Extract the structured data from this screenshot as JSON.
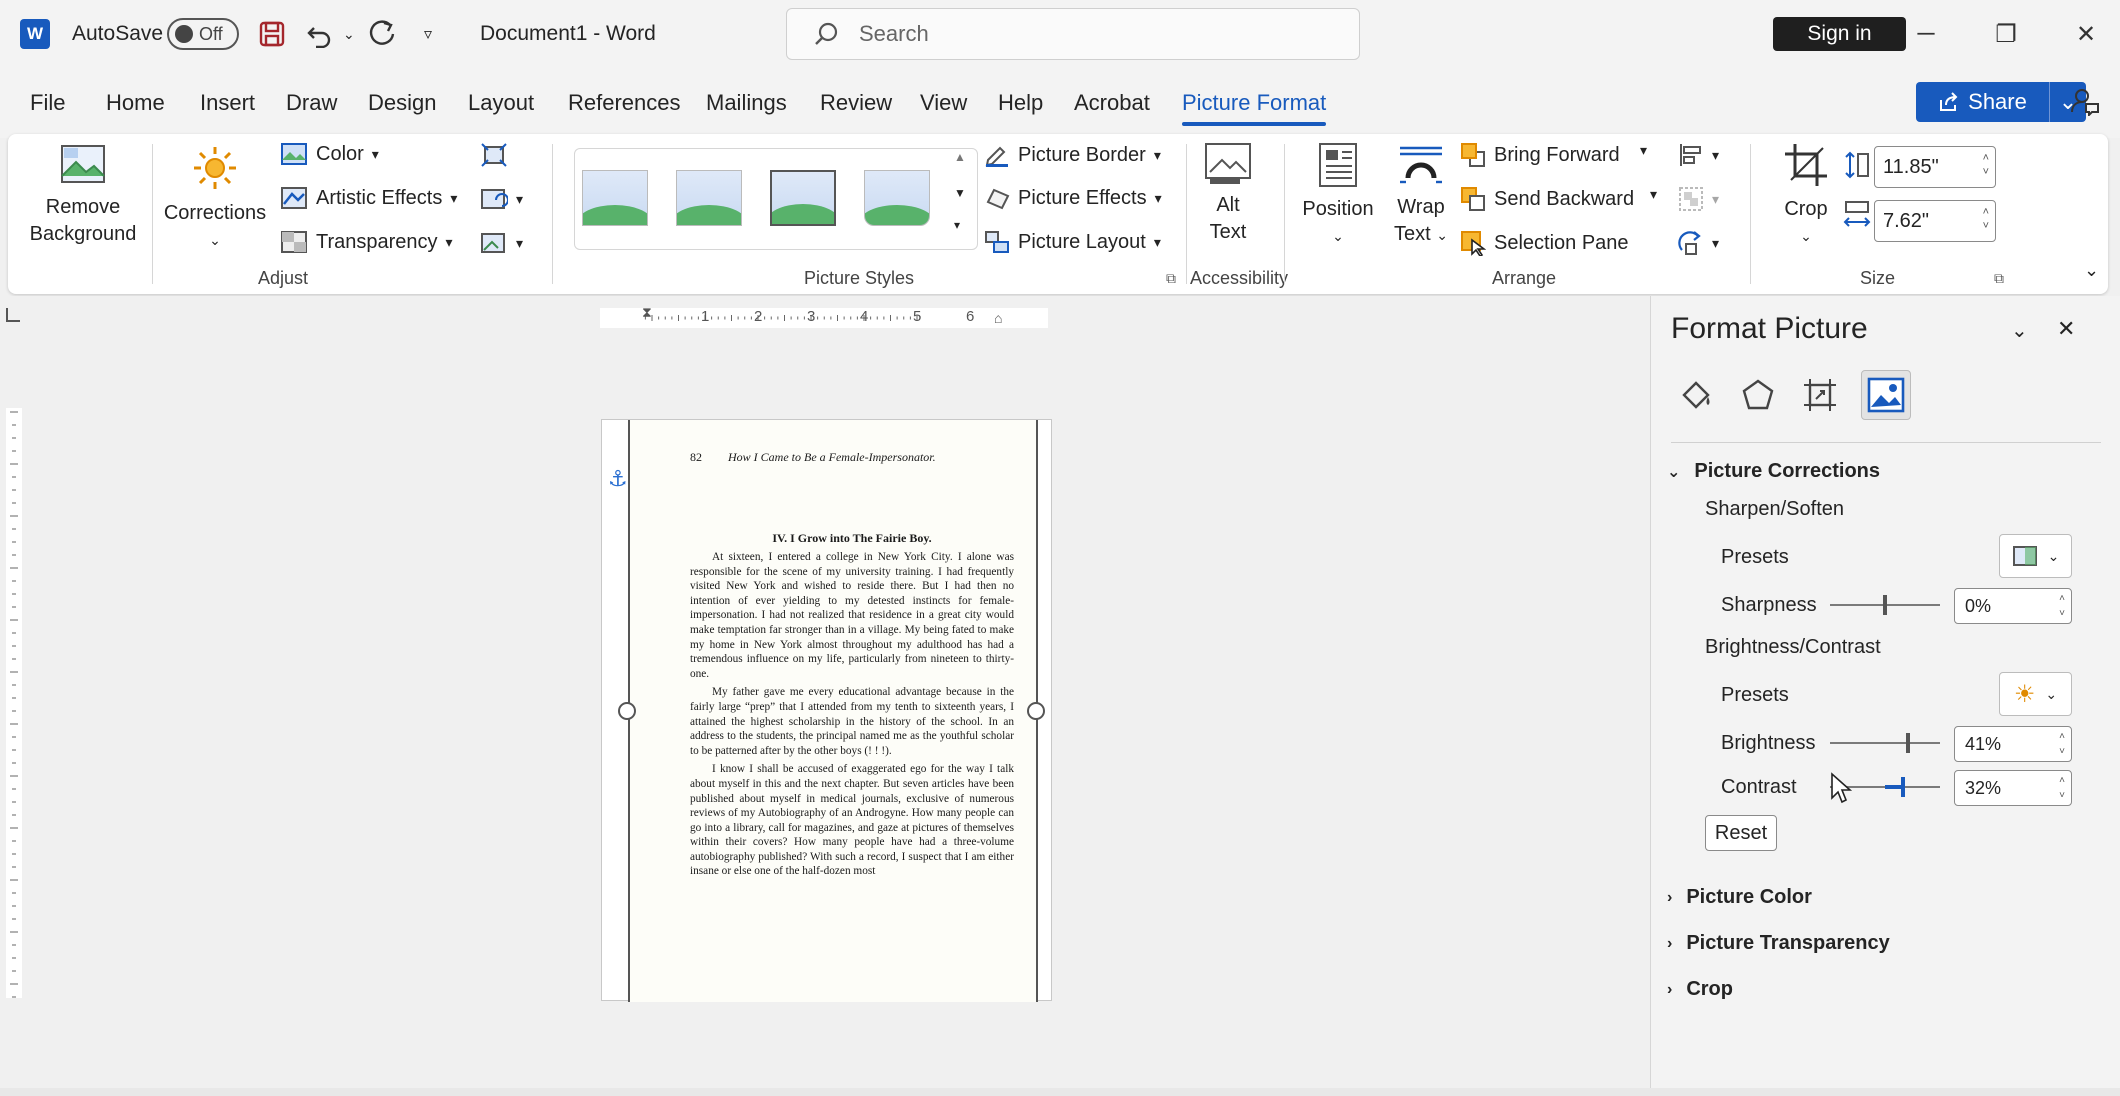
{
  "titlebar": {
    "app_logo": "W",
    "autosave_label": "AutoSave",
    "autosave_state": "Off",
    "doc_title": "Document1  -  Word",
    "search_placeholder": "Search",
    "signin_label": "Sign in",
    "minimize": "─",
    "restore": "❐",
    "close": "✕"
  },
  "tabs": [
    "File",
    "Home",
    "Insert",
    "Draw",
    "Design",
    "Layout",
    "References",
    "Mailings",
    "Review",
    "View",
    "Help",
    "Acrobat",
    "Picture Format"
  ],
  "active_tab": "Picture Format",
  "share_label": "Share",
  "ribbon": {
    "remove_bg": [
      "Remove",
      "Background"
    ],
    "corrections": "Corrections",
    "color": "Color",
    "artistic": "Artistic Effects",
    "transparency": "Transparency",
    "adjust_label": "Adjust",
    "styles_label": "Picture Styles",
    "border": "Picture Border",
    "effects": "Picture Effects",
    "layout": "Picture Layout",
    "alt_text": [
      "Alt",
      "Text"
    ],
    "accessibility_label": "Accessibility",
    "position": "Position",
    "wrap_text": [
      "Wrap",
      "Text"
    ],
    "bring_forward": "Bring Forward",
    "send_backward": "Send Backward",
    "selection_pane": "Selection Pane",
    "arrange_label": "Arrange",
    "crop": "Crop",
    "height": "11.85\"",
    "width": "7.62\"",
    "size_label": "Size"
  },
  "ruler_numbers": [
    "1",
    "2",
    "3",
    "4",
    "5",
    "6"
  ],
  "document": {
    "page_number": "82",
    "running_head": "How I Came to Be a Female-Impersonator.",
    "chapter": "IV.   I Grow into The Fairie Boy.",
    "paragraphs": [
      "At sixteen, I entered a college in New York City. I alone was responsible for the scene of my university training. I had frequently visited New York and wished to reside there. But I had then no intention of ever yielding to my detested instincts for female-impersonation. I had not realized that residence in a great city would make temptation far stronger than in a village. My being fated to make my home in New York almost throughout my adulthood has had a tremendous influence on my life, particularly from nineteen to thirty-one.",
      "My father gave me every educational advantage because in the fairly large “prep” that I attended from my tenth to sixteenth years, I attained the highest scholarship in the history of the school. In an address to the students, the principal named me as the youthful scholar to be patterned after by the other boys (! ! !).",
      "I know I shall be accused of exaggerated ego for the way I talk about myself in this and the next chapter. But seven articles have been published about myself in medical journals, exclusive of numerous reviews of my Autobiography of an Androgyne. How many people can go into a library, call for magazines, and gaze at pictures of themselves within their covers? How many people have had a three-volume autobiography published? With such a record, I suspect that I am either insane or else one of the half-dozen most"
    ]
  },
  "pane": {
    "title": "Format Picture",
    "section_corrections": "Picture Corrections",
    "sharpen_heading": "Sharpen/Soften",
    "presets_label": "Presets",
    "sharpness_label": "Sharpness",
    "sharpness_value": "0%",
    "sharpness_level": 0.5,
    "bc_heading": "Brightness/Contrast",
    "presets2_label": "Presets",
    "brightness_label": "Brightness",
    "brightness_value": "41%",
    "contrast_label": "Contrast",
    "contrast_value": "32%",
    "reset_label": "Reset",
    "section_color": "Picture Color",
    "section_transparency": "Picture Transparency",
    "section_crop": "Crop"
  },
  "colors": {
    "accent": "#185abd",
    "titlebar_bg": "#f3f3f3",
    "ribbon_bg": "#ffffff"
  }
}
